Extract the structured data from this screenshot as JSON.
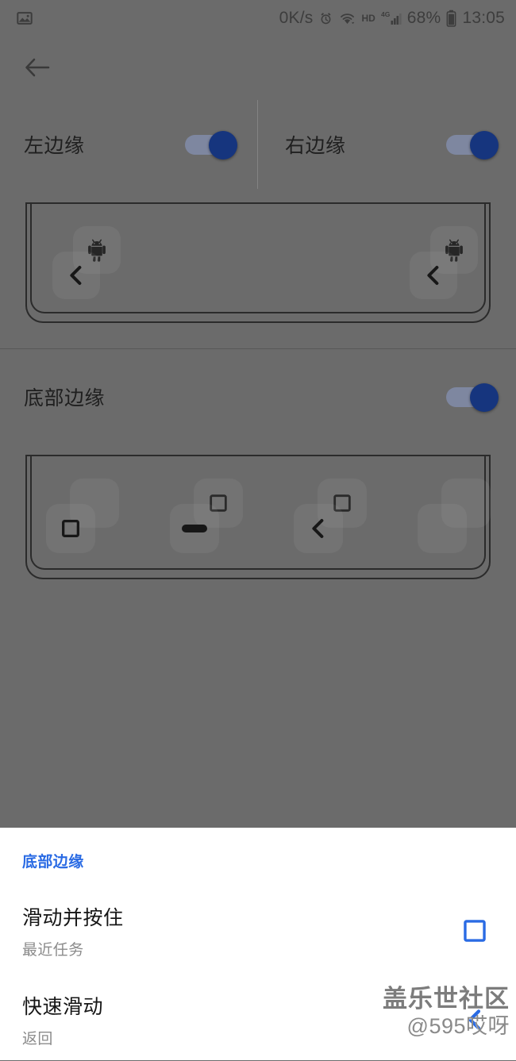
{
  "statusbar": {
    "left_icon": "image-notification-icon",
    "network_speed": "0K/s",
    "alarm_icon": "alarm-clock-icon",
    "wifi_icon": "wifi-icon",
    "hd_label": "HD",
    "signal_label": "4G",
    "signal_icon": "cellular-signal-icon",
    "battery_percent": "68%",
    "battery_icon": "battery-icon",
    "clock": "13:05"
  },
  "navbar": {
    "back_icon": "back-arrow-icon"
  },
  "edges": {
    "left": {
      "label": "左边缘",
      "enabled": true
    },
    "right": {
      "label": "右边缘",
      "enabled": true
    },
    "bottom": {
      "label": "底部边缘",
      "enabled": true
    }
  },
  "side_preview": {
    "left_slot": {
      "app_icon": "android-robot-icon",
      "gesture_icon": "back-chevron-icon"
    },
    "right_slot": {
      "app_icon": "android-robot-icon",
      "gesture_icon": "back-chevron-icon"
    }
  },
  "bottom_preview": {
    "slots": [
      {
        "gesture_icon": "recents-square-icon"
      },
      {
        "gesture_icon": "home-pill-icon"
      },
      {
        "gesture_icon": "back-chevron-icon"
      },
      {
        "gesture_icon": "empty-icon"
      }
    ]
  },
  "sheet": {
    "title": "底部边缘",
    "items": [
      {
        "title": "滑动并按住",
        "subtitle": "最近任务",
        "icon": "recents-square-icon"
      },
      {
        "title": "快速滑动",
        "subtitle": "返回",
        "icon": "back-chevron-icon"
      }
    ]
  },
  "watermark": {
    "line1": "盖乐世社区",
    "line2": "@595哎呀"
  },
  "colors": {
    "background": "#6b6b6b",
    "accent_blue": "#2a6be4",
    "switch_thumb": "#16357e",
    "switch_track": "#7e87a0",
    "sheet_background": "#ffffff"
  }
}
